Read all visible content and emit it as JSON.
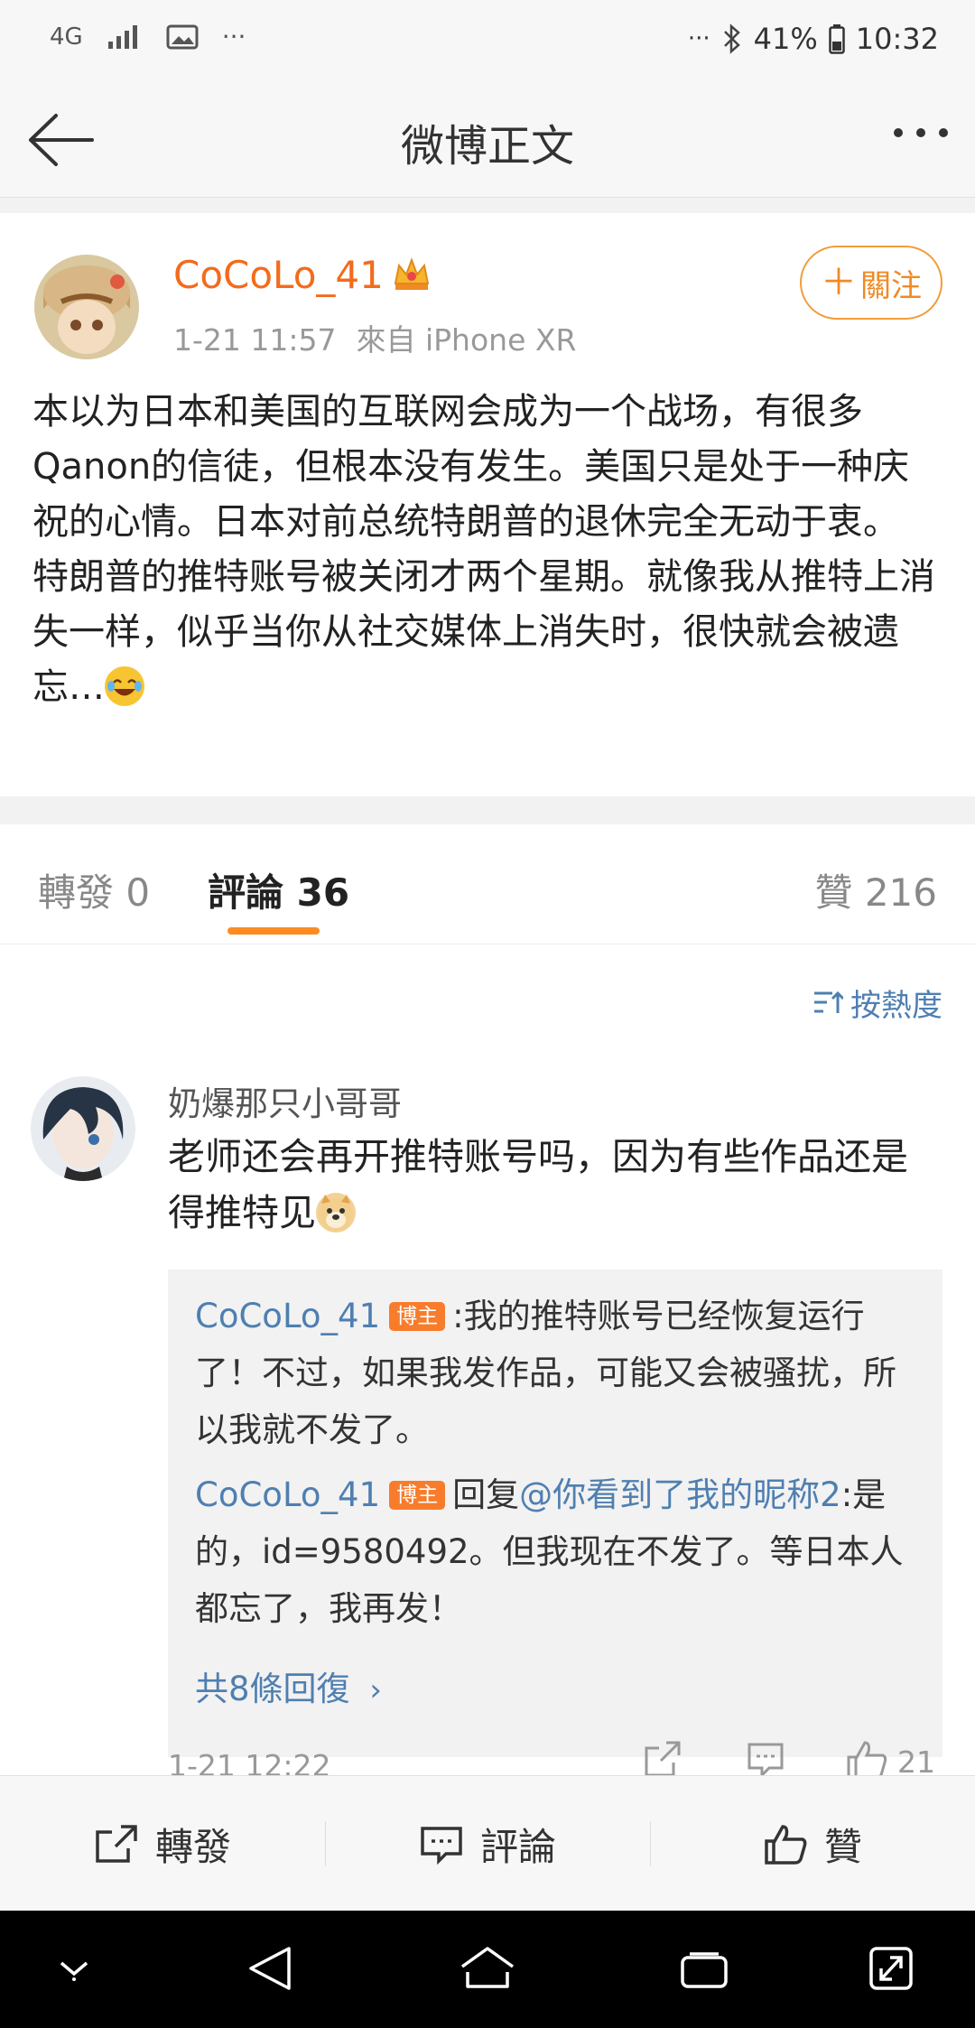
{
  "status_bar": {
    "network": "4G",
    "more_left": "···",
    "more_right": "···",
    "battery": "41%",
    "time": "10:32"
  },
  "header": {
    "title": "微博正文"
  },
  "post": {
    "author": "CoCoLo_41",
    "time": "1-21 11:57",
    "source": "來自 iPhone XR",
    "follow_label": "關注",
    "text": "本以为日本和美国的互联网会成为一个战场，有很多Qanon的信徒，但根本没有发生。美国只是处于一种庆祝的心情。日本对前总统特朗普的退休完全无动于衷。\n特朗普的推特账号被关闭才两个星期。就像我从推特上消失一样，似乎当你从社交媒体上消失时，很快就会被遗忘…"
  },
  "tabs": [
    {
      "label": "轉發",
      "count": "0"
    },
    {
      "label": "評論",
      "count": "36"
    },
    {
      "label": "贊",
      "count": "216"
    }
  ],
  "sort_label": "按熱度",
  "comment": {
    "user": "奶爆那只小哥哥",
    "text": "老师还会再开推特账号吗，因为有些作品还是得推特见",
    "replies": [
      {
        "user": "CoCoLo_41",
        "badge": "博主",
        "text": ":我的推特账号已经恢复运行了！不过，如果我发作品，可能又会被骚扰，所以我就不发了。"
      },
      {
        "user": "CoCoLo_41",
        "badge": "博主",
        "prefix": "回复",
        "mention": "@你看到了我的昵称2",
        "text": ":是的，id=9580492。但我现在不发了。等日本人都忘了，我再发！"
      }
    ],
    "more_replies": "共8條回復",
    "time": "1-21 12:22",
    "likes": "21"
  },
  "toolbar": {
    "repost": "轉發",
    "comment": "評論",
    "like": "贊"
  }
}
